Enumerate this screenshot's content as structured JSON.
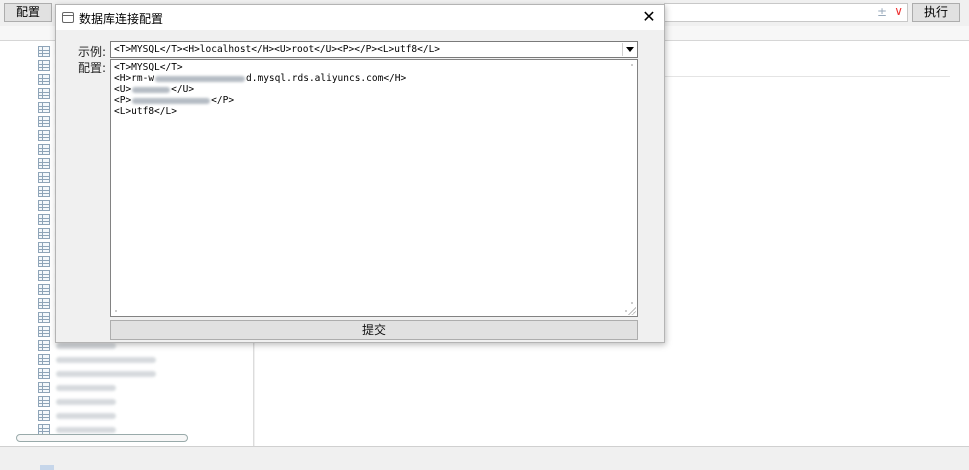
{
  "toolbar": {
    "config_label": "配置",
    "execute_label": "执行",
    "plus_minus": "±"
  },
  "dialog": {
    "title": "数据库连接配置",
    "close_symbol": "✕",
    "example_label": "示例:",
    "config_label": "配置:",
    "example_value": "<T>MYSQL</T><H>localhost</H><U>root</U><P></P><L>utf8</L>",
    "config_lines": {
      "line1": "<T>MYSQL</T>",
      "line2_prefix": "<H>rm-w",
      "line2_suffix": "d.mysql.rds.aliyuncs.com</H>",
      "line3_prefix": "<U>",
      "line3_suffix": "</U>",
      "line4_prefix": "<P>",
      "line4_suffix": "</P>",
      "line5": "<L>utf8</L>"
    },
    "submit_label": "提交"
  }
}
